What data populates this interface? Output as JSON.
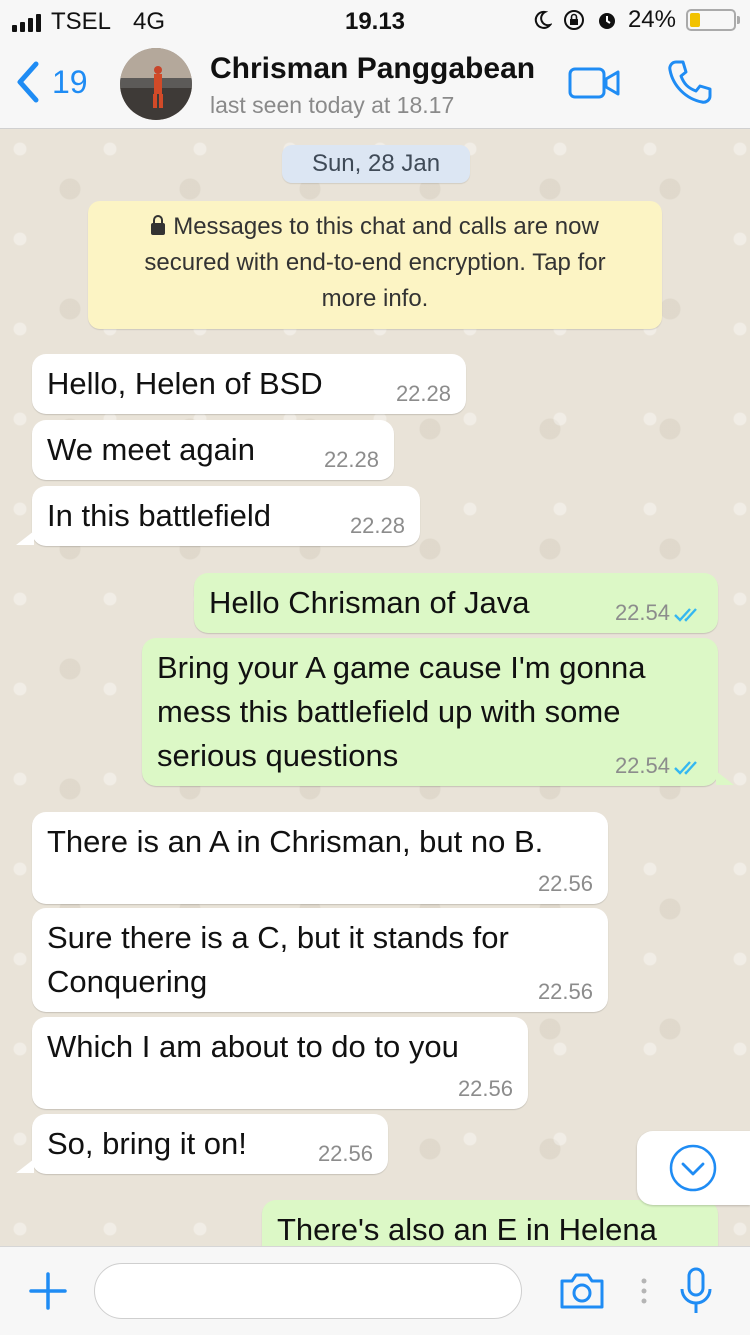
{
  "status_bar": {
    "carrier": "TSEL",
    "network": "4G",
    "time": "19.13",
    "battery_percent": "24%",
    "battery_level": 0.24
  },
  "header": {
    "back_count": "19",
    "contact_name": "Chrisman Panggabean",
    "last_seen": "last seen today at 18.17"
  },
  "chat": {
    "date": "Sun, 28 Jan",
    "encryption_notice": [
      "Messages to this chat and calls are now",
      "secured with end-to-end encryption. Tap for",
      "more info."
    ],
    "messages": [
      {
        "dir": "in",
        "lines": [
          "Hello, Helen of BSD"
        ],
        "time": "22.28"
      },
      {
        "dir": "in",
        "lines": [
          "We meet again"
        ],
        "time": "22.28"
      },
      {
        "dir": "in",
        "lines": [
          "In this battlefield"
        ],
        "time": "22.28"
      },
      {
        "dir": "out",
        "lines": [
          "Hello Chrisman of Java"
        ],
        "time": "22.54",
        "read": true
      },
      {
        "dir": "out",
        "lines": [
          "Bring your A game cause I'm gonna",
          "mess this battlefield up with some",
          "serious questions"
        ],
        "time": "22.54",
        "read": true
      },
      {
        "dir": "in",
        "lines": [
          "There is an A in Chrisman, but no B."
        ],
        "time": "22.56"
      },
      {
        "dir": "in",
        "lines": [
          "Sure there is a C, but it stands for",
          "Conquering"
        ],
        "time": "22.56"
      },
      {
        "dir": "in",
        "lines": [
          "Which I am about to do to you"
        ],
        "time": "22.56"
      },
      {
        "dir": "in",
        "lines": [
          "So, bring it on!"
        ],
        "time": "22.56"
      },
      {
        "dir": "out",
        "lines": [
          "There's also an E in Helena"
        ],
        "time": ""
      }
    ]
  },
  "input_bar": {
    "placeholder": ""
  },
  "colors": {
    "accent": "#1f8cf4",
    "outgoing_bubble": "#dcf8c6",
    "incoming_bubble": "#ffffff",
    "read_ticks": "#34b7f1"
  },
  "icons": [
    "signal-icon",
    "moon-icon",
    "rotation-lock-icon",
    "alarm-icon",
    "battery-icon",
    "back-chevron-icon",
    "video-call-icon",
    "phone-call-icon",
    "lock-icon",
    "double-check-icon",
    "scroll-down-icon",
    "plus-icon",
    "camera-icon",
    "mic-icon"
  ]
}
